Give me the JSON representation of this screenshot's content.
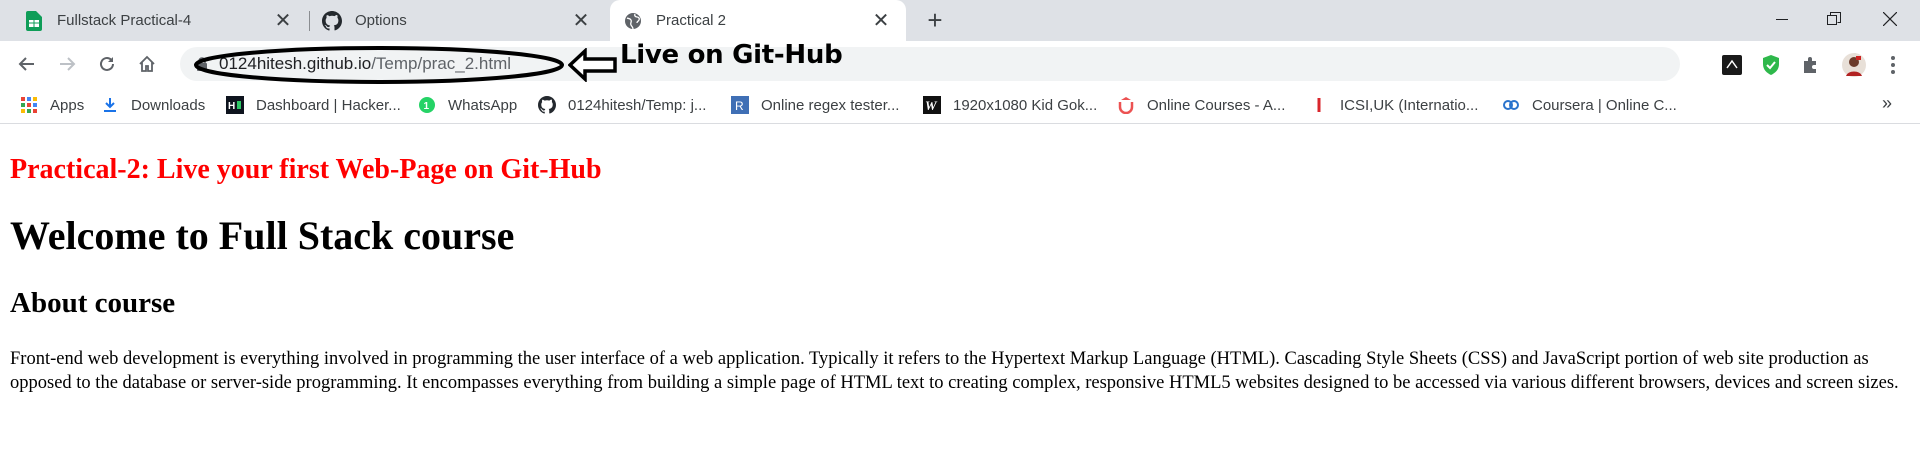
{
  "tabs": [
    {
      "title": "Fullstack Practical-4",
      "icon": "sheets-icon",
      "active": false
    },
    {
      "title": "Options",
      "icon": "github-icon",
      "active": false
    },
    {
      "title": "Practical 2",
      "icon": "globe-icon",
      "active": true
    }
  ],
  "toolbar": {
    "url_host": "0124hitesh.github.io",
    "url_path": "/Temp/prac_2.html"
  },
  "annotation": {
    "text": "Live on Git-Hub",
    "color": "#000000"
  },
  "bookmarks": [
    {
      "label": "Apps",
      "icon": "apps-grid-icon"
    },
    {
      "label": "Downloads",
      "icon": "download-icon"
    },
    {
      "label": "Dashboard | Hacker...",
      "icon": "hackerrank-icon"
    },
    {
      "label": "WhatsApp",
      "icon": "whatsapp-icon"
    },
    {
      "label": "0124hitesh/Temp: j...",
      "icon": "github-icon"
    },
    {
      "label": "Online regex tester...",
      "icon": "regex-icon"
    },
    {
      "label": "1920x1080 Kid Gok...",
      "icon": "wallpaper-icon"
    },
    {
      "label": "Online Courses - A...",
      "icon": "udemy-icon"
    },
    {
      "label": "ICSI,UK (Internatio...",
      "icon": "icsi-icon"
    },
    {
      "label": "Coursera | Online C...",
      "icon": "coursera-icon"
    }
  ],
  "page": {
    "practical_title": "Practical-2: Live your first Web-Page on Git-Hub",
    "welcome_heading": "Welcome to Full Stack course",
    "about_heading": "About course",
    "paragraph": "Front-end web development is everything involved in programming the user interface of a web application. Typically it refers to the Hypertext Markup Language (HTML). Cascading Style Sheets (CSS) and JavaScript portion of web site production as opposed to the database or server-side programming. It encompasses everything from building a simple page of HTML text to creating complex, responsive HTML5 websites designed to be accessed via various different browsers, devices and screen sizes."
  },
  "colors": {
    "practical_title": "#ff0000",
    "tabstrip_bg": "#dee1e6",
    "omnibox_bg": "#f1f3f4"
  }
}
